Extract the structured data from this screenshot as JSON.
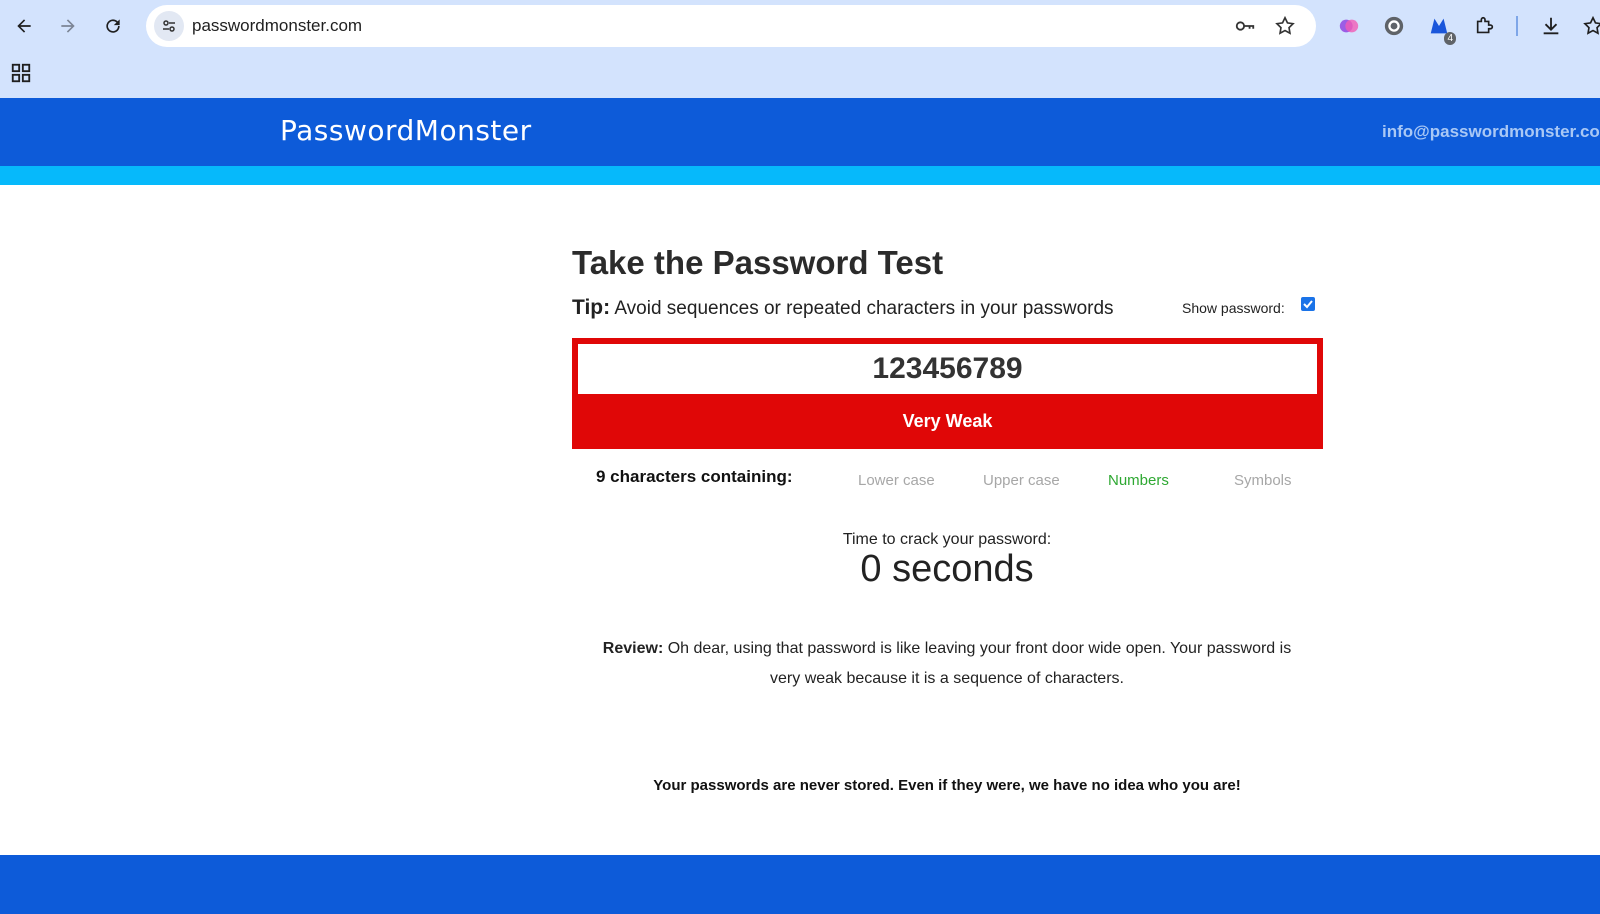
{
  "browser": {
    "url": "passwordmonster.com",
    "extension_badge": "4"
  },
  "site": {
    "logo": "PasswordMonster",
    "email": "info@passwordmonster.co"
  },
  "main": {
    "title": "Take the Password Test",
    "tip_label": "Tip:",
    "tip_text": "Avoid sequences or repeated characters in your passwords",
    "show_password_label": "Show password:",
    "show_password_checked": true,
    "password_value": "123456789",
    "strength": "Very Weak",
    "strength_color": "#e00707",
    "chars_label": "9 characters containing:",
    "char_types": [
      {
        "label": "Lower case",
        "present": false
      },
      {
        "label": "Upper case",
        "present": false
      },
      {
        "label": "Numbers",
        "present": true
      },
      {
        "label": "Symbols",
        "present": false
      }
    ],
    "crack_label": "Time to crack your password:",
    "crack_time": "0 seconds",
    "review_label": "Review:",
    "review_text": "Oh dear, using that password is like leaving your front door wide open. Your password is very weak because it is a sequence of characters.",
    "notice": "Your passwords are never stored. Even if they were, we have no idea who you are!"
  },
  "colors": {
    "brand_blue": "#0d5bd9",
    "stripe_cyan": "#06b9fb",
    "present_green": "#2ea832",
    "absent_gray": "#a7a7a7"
  }
}
